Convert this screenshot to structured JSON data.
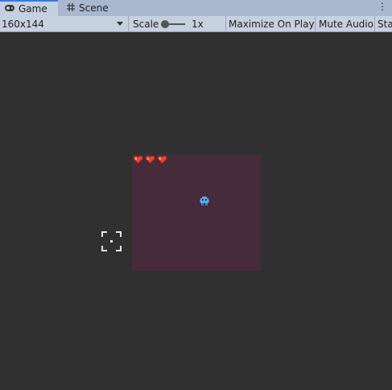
{
  "tabs": [
    {
      "label": "Game",
      "icon": "gamepad-icon",
      "active": true
    },
    {
      "label": "Scene",
      "icon": "grid-hash-icon",
      "active": false
    }
  ],
  "tab_menu_glyph": "⋮",
  "toolbar": {
    "resolution": "160x144",
    "scale_label": "Scale",
    "scale_value": "1x",
    "scale_fraction": 0.0,
    "maximize_label": "Maximize On Play",
    "mute_label": "Mute Audio",
    "stats_label": "Stats"
  },
  "game": {
    "hearts_count": 3,
    "heart_color": "#e04838",
    "player_color": "#5aaee8",
    "background_color": "#462b3a"
  },
  "colors": {
    "viewport_bg": "#303030",
    "tab_active_accent": "#3b78d9"
  }
}
